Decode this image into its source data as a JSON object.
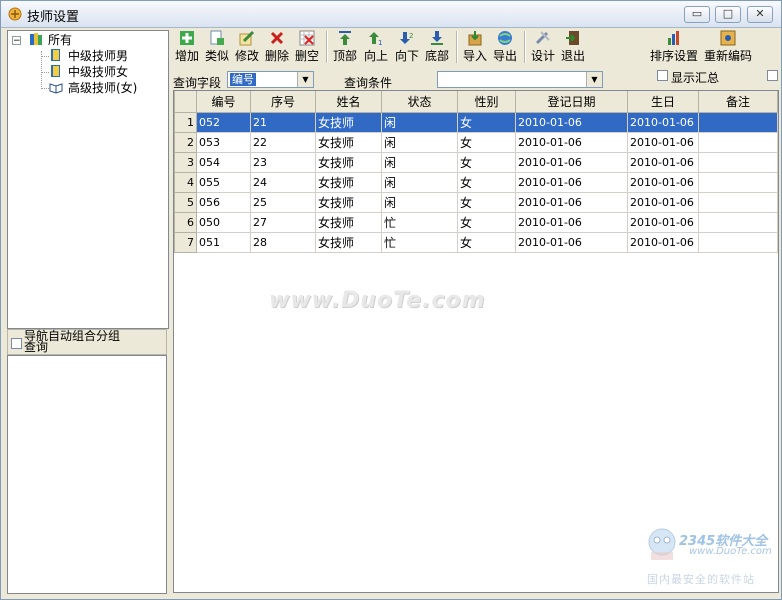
{
  "window": {
    "title": "技师设置",
    "min": "▭",
    "max": "□",
    "close": "✕"
  },
  "tree": {
    "toggle": "−",
    "root": "所有",
    "children": [
      "中级技师男",
      "中级技师女",
      "高级技师(女)"
    ]
  },
  "nav_group": {
    "label_line1": "导航自动组合分组",
    "label_line2": "查询"
  },
  "toolbar": {
    "add": "增加",
    "similar": "类似",
    "edit": "修改",
    "delete": "删除",
    "clear": "删空",
    "top": "顶部",
    "up": "向上",
    "down": "向下",
    "bottom": "底部",
    "import": "导入",
    "export": "导出",
    "design": "设计",
    "exit": "退出",
    "sort_settings": "排序设置",
    "renumber": "重新编码"
  },
  "query": {
    "field_label": "查询字段",
    "field_value": "编号",
    "condition_label": "查询条件",
    "condition_value": "",
    "show_summary": "显示汇总"
  },
  "grid": {
    "columns": [
      "编号",
      "序号",
      "姓名",
      "状态",
      "性别",
      "登记日期",
      "生日",
      "备注"
    ],
    "rows": [
      {
        "n": "1",
        "c": [
          "052",
          "21",
          "女技师",
          "闲",
          "女",
          "2010-01-06",
          "2010-01-06",
          ""
        ]
      },
      {
        "n": "2",
        "c": [
          "053",
          "22",
          "女技师",
          "闲",
          "女",
          "2010-01-06",
          "2010-01-06",
          ""
        ]
      },
      {
        "n": "3",
        "c": [
          "054",
          "23",
          "女技师",
          "闲",
          "女",
          "2010-01-06",
          "2010-01-06",
          ""
        ]
      },
      {
        "n": "4",
        "c": [
          "055",
          "24",
          "女技师",
          "闲",
          "女",
          "2010-01-06",
          "2010-01-06",
          ""
        ]
      },
      {
        "n": "5",
        "c": [
          "056",
          "25",
          "女技师",
          "闲",
          "女",
          "2010-01-06",
          "2010-01-06",
          ""
        ]
      },
      {
        "n": "6",
        "c": [
          "050",
          "27",
          "女技师",
          "忙",
          "女",
          "2010-01-06",
          "2010-01-06",
          ""
        ]
      },
      {
        "n": "7",
        "c": [
          "051",
          "28",
          "女技师",
          "忙",
          "女",
          "2010-01-06",
          "2010-01-06",
          ""
        ]
      }
    ],
    "selected_row": 0
  },
  "watermarks": {
    "main": "www.DuoTe.com",
    "corner_brand": "2345软件大全",
    "corner_url": "www.DuoTe.com",
    "corner_tagline": "国内最安全的软件站"
  },
  "colors": {
    "selection": "#316ac5",
    "window_bg": "#ece9d8"
  }
}
